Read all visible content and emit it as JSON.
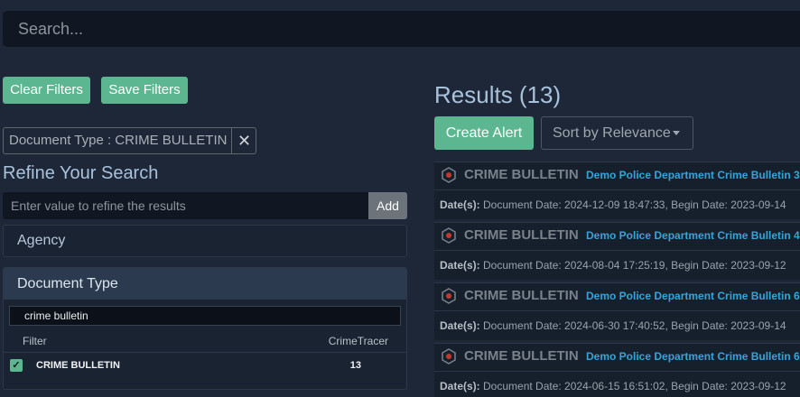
{
  "search": {
    "placeholder": "Search..."
  },
  "filters": {
    "clear_label": "Clear Filters",
    "save_label": "Save Filters"
  },
  "active_chip": {
    "label": "Document Type : CRIME BULLETIN",
    "remove_glyph": "✕"
  },
  "refine": {
    "title": "Refine Your Search",
    "placeholder": "Enter value to refine the results",
    "add_label": "Add"
  },
  "agency": {
    "label": "Agency"
  },
  "doctype": {
    "heading": "Document Type",
    "filter_value": "crime bulletin",
    "col_filter": "Filter",
    "col_source": "CrimeTracer",
    "rows": [
      {
        "name": "CRIME BULLETIN",
        "count": "13",
        "checked": true
      }
    ]
  },
  "results": {
    "title": "Results (13)",
    "create_alert": "Create Alert",
    "sort_label": "Sort by Relevance",
    "items": [
      {
        "type": "CRIME BULLETIN",
        "title": "Demo Police Department Crime Bulletin 3",
        "dates_label": "Date(s):",
        "dates": "Document Date: 2024-12-09 18:47:33, Begin Date: 2023-09-14"
      },
      {
        "type": "CRIME BULLETIN",
        "title": "Demo Police Department Crime Bulletin 4",
        "dates_label": "Date(s):",
        "dates": "Document Date: 2024-08-04 17:25:19, Begin Date: 2023-09-12"
      },
      {
        "type": "CRIME BULLETIN",
        "title": "Demo Police Department Crime Bulletin 6",
        "dates_label": "Date(s):",
        "dates": "Document Date: 2024-06-30 17:40:52, Begin Date: 2023-09-14"
      },
      {
        "type": "CRIME BULLETIN",
        "title": "Demo Police Department Crime Bulletin 6",
        "dates_label": "Date(s):",
        "dates": "Document Date: 2024-06-15 16:51:02, Begin Date: 2023-09-12"
      }
    ]
  },
  "colors": {
    "accent": "#5cb791",
    "link": "#34a5d9",
    "background": "#1e2737"
  }
}
